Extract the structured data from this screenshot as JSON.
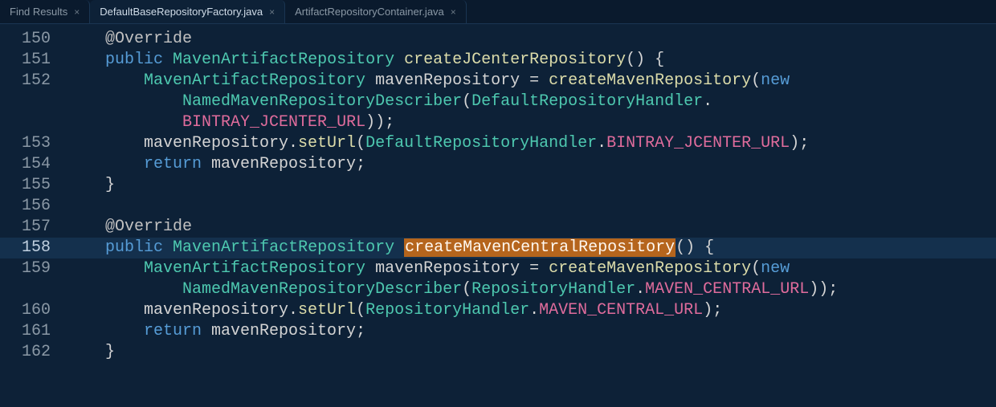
{
  "tabs": [
    {
      "label": "Find Results",
      "active": false
    },
    {
      "label": "DefaultBaseRepositoryFactory.java",
      "active": true
    },
    {
      "label": "ArtifactRepositoryContainer.java",
      "active": false
    }
  ],
  "gutter": {
    "start": 150,
    "end": 162,
    "current": 158
  },
  "code": {
    "lines": [
      {
        "n": 150,
        "segments": [
          {
            "t": "    ",
            "c": ""
          },
          {
            "t": "@Override",
            "c": "tok-annotation"
          }
        ]
      },
      {
        "n": 151,
        "segments": [
          {
            "t": "    ",
            "c": ""
          },
          {
            "t": "public",
            "c": "tok-keyword2"
          },
          {
            "t": " ",
            "c": ""
          },
          {
            "t": "MavenArtifactRepository",
            "c": "tok-type"
          },
          {
            "t": " ",
            "c": ""
          },
          {
            "t": "createJCenterRepository",
            "c": "tok-method"
          },
          {
            "t": "() {",
            "c": "tok-punct"
          }
        ]
      },
      {
        "n": 152,
        "segments": [
          {
            "t": "        ",
            "c": ""
          },
          {
            "t": "MavenArtifactRepository",
            "c": "tok-type"
          },
          {
            "t": " mavenRepository = ",
            "c": "tok-ident"
          },
          {
            "t": "createMavenRepository",
            "c": "tok-method"
          },
          {
            "t": "(",
            "c": "tok-punct"
          },
          {
            "t": "new",
            "c": "tok-new"
          }
        ]
      },
      {
        "n": 152,
        "wrap": true,
        "segments": [
          {
            "t": "            ",
            "c": ""
          },
          {
            "t": "NamedMavenRepositoryDescriber",
            "c": "tok-type"
          },
          {
            "t": "(",
            "c": "tok-punct"
          },
          {
            "t": "DefaultRepositoryHandler",
            "c": "tok-type"
          },
          {
            "t": ".",
            "c": "tok-punct"
          }
        ]
      },
      {
        "n": 152,
        "wrap": true,
        "segments": [
          {
            "t": "            ",
            "c": ""
          },
          {
            "t": "BINTRAY_JCENTER_URL",
            "c": "tok-const"
          },
          {
            "t": "));",
            "c": "tok-punct"
          }
        ]
      },
      {
        "n": 153,
        "segments": [
          {
            "t": "        mavenRepository.",
            "c": "tok-ident"
          },
          {
            "t": "setUrl",
            "c": "tok-method"
          },
          {
            "t": "(",
            "c": "tok-punct"
          },
          {
            "t": "DefaultRepositoryHandler",
            "c": "tok-type"
          },
          {
            "t": ".",
            "c": "tok-punct"
          },
          {
            "t": "BINTRAY_JCENTER_URL",
            "c": "tok-const"
          },
          {
            "t": ");",
            "c": "tok-punct"
          }
        ]
      },
      {
        "n": 154,
        "segments": [
          {
            "t": "        ",
            "c": ""
          },
          {
            "t": "return",
            "c": "tok-keyword2"
          },
          {
            "t": " mavenRepository;",
            "c": "tok-ident"
          }
        ]
      },
      {
        "n": 155,
        "segments": [
          {
            "t": "    }",
            "c": "tok-punct"
          }
        ]
      },
      {
        "n": 156,
        "segments": [
          {
            "t": "",
            "c": ""
          }
        ]
      },
      {
        "n": 157,
        "segments": [
          {
            "t": "    ",
            "c": ""
          },
          {
            "t": "@Override",
            "c": "tok-annotation"
          }
        ]
      },
      {
        "n": 158,
        "current": true,
        "segments": [
          {
            "t": "    ",
            "c": ""
          },
          {
            "t": "public",
            "c": "tok-keyword2"
          },
          {
            "t": " ",
            "c": ""
          },
          {
            "t": "MavenArtifactRepository",
            "c": "tok-type"
          },
          {
            "t": " ",
            "c": ""
          },
          {
            "t": "createMavenCentralRepository",
            "c": "tok-method",
            "hl": true
          },
          {
            "t": "() {",
            "c": "tok-punct"
          }
        ]
      },
      {
        "n": 159,
        "segments": [
          {
            "t": "        ",
            "c": ""
          },
          {
            "t": "MavenArtifactRepository",
            "c": "tok-type"
          },
          {
            "t": " mavenRepository = ",
            "c": "tok-ident"
          },
          {
            "t": "createMavenRepository",
            "c": "tok-method"
          },
          {
            "t": "(",
            "c": "tok-punct"
          },
          {
            "t": "new",
            "c": "tok-new"
          }
        ]
      },
      {
        "n": 159,
        "wrap": true,
        "segments": [
          {
            "t": "            ",
            "c": ""
          },
          {
            "t": "NamedMavenRepositoryDescriber",
            "c": "tok-type"
          },
          {
            "t": "(",
            "c": "tok-punct"
          },
          {
            "t": "RepositoryHandler",
            "c": "tok-type"
          },
          {
            "t": ".",
            "c": "tok-punct"
          },
          {
            "t": "MAVEN_CENTRAL_URL",
            "c": "tok-const"
          },
          {
            "t": "));",
            "c": "tok-punct"
          }
        ]
      },
      {
        "n": 160,
        "segments": [
          {
            "t": "        mavenRepository.",
            "c": "tok-ident"
          },
          {
            "t": "setUrl",
            "c": "tok-method"
          },
          {
            "t": "(",
            "c": "tok-punct"
          },
          {
            "t": "RepositoryHandler",
            "c": "tok-type"
          },
          {
            "t": ".",
            "c": "tok-punct"
          },
          {
            "t": "MAVEN_CENTRAL_URL",
            "c": "tok-const"
          },
          {
            "t": ");",
            "c": "tok-punct"
          }
        ]
      },
      {
        "n": 161,
        "segments": [
          {
            "t": "        ",
            "c": ""
          },
          {
            "t": "return",
            "c": "tok-keyword2"
          },
          {
            "t": " mavenRepository;",
            "c": "tok-ident"
          }
        ]
      },
      {
        "n": 162,
        "segments": [
          {
            "t": "    }",
            "c": "tok-punct"
          }
        ]
      }
    ]
  }
}
